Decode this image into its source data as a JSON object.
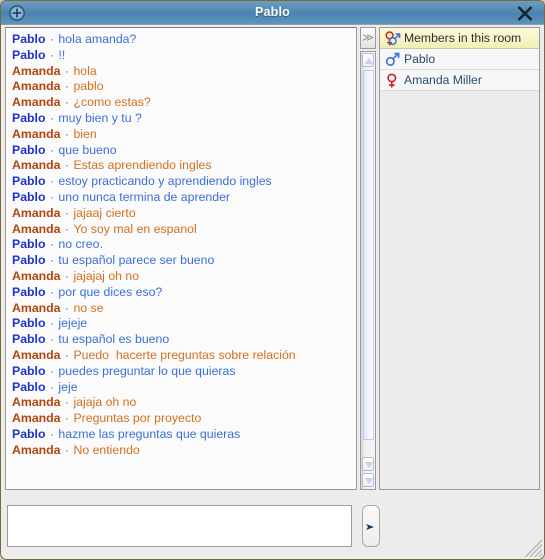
{
  "window": {
    "title": "Pablo",
    "add_icon": "circle-plus-icon",
    "close_icon": "close-icon",
    "close_label": "✕"
  },
  "colors": {
    "titlebar_blue": "#5089b4",
    "pablo_name": "#1b35cc",
    "pablo_text": "#3a6fd8",
    "amanda_name": "#b04510",
    "amanda_text": "#d4701e",
    "members_header_bg": "#f0eeb4",
    "member_text": "#2b4a6f",
    "mars_blue": "#3a6fd8",
    "venus_red": "#d01f1f"
  },
  "chat": {
    "separator": "·",
    "messages": [
      {
        "sender": "Pablo",
        "side": "pablo",
        "text": "hola amanda?"
      },
      {
        "sender": "Pablo",
        "side": "pablo",
        "text": "!!"
      },
      {
        "sender": "Amanda",
        "side": "amanda",
        "text": "hola"
      },
      {
        "sender": "Amanda",
        "side": "amanda",
        "text": "pablo"
      },
      {
        "sender": "Amanda",
        "side": "amanda",
        "text": "¿como estas?"
      },
      {
        "sender": "Pablo",
        "side": "pablo",
        "text": "muy bien y tu ?"
      },
      {
        "sender": "Amanda",
        "side": "amanda",
        "text": "bien"
      },
      {
        "sender": "Pablo",
        "side": "pablo",
        "text": "que bueno"
      },
      {
        "sender": "Amanda",
        "side": "amanda",
        "text": "Estas aprendiendo ingles"
      },
      {
        "sender": "Pablo",
        "side": "pablo",
        "text": "estoy practicando y aprendiendo ingles"
      },
      {
        "sender": "Pablo",
        "side": "pablo",
        "text": "uno nunca termina de aprender"
      },
      {
        "sender": "Amanda",
        "side": "amanda",
        "text": "jajaaj cierto"
      },
      {
        "sender": "Amanda",
        "side": "amanda",
        "text": "Yo soy mal en espanol"
      },
      {
        "sender": "Pablo",
        "side": "pablo",
        "text": "no creo."
      },
      {
        "sender": "Pablo",
        "side": "pablo",
        "text": "tu español parece ser bueno"
      },
      {
        "sender": "Amanda",
        "side": "amanda",
        "text": "jajajaj oh no"
      },
      {
        "sender": "Pablo",
        "side": "pablo",
        "text": "por que dices eso?"
      },
      {
        "sender": "Amanda",
        "side": "amanda",
        "text": "no se"
      },
      {
        "sender": "Pablo",
        "side": "pablo",
        "text": "jejeje"
      },
      {
        "sender": "Pablo",
        "side": "pablo",
        "text": "tu español es bueno"
      },
      {
        "sender": "Amanda",
        "side": "amanda",
        "text": "Puedo  hacerte preguntas sobre relación"
      },
      {
        "sender": "Pablo",
        "side": "pablo",
        "text": "puedes preguntar lo que quieras"
      },
      {
        "sender": "Pablo",
        "side": "pablo",
        "text": "jeje"
      },
      {
        "sender": "Amanda",
        "side": "amanda",
        "text": "jajaja oh no"
      },
      {
        "sender": "Amanda",
        "side": "amanda",
        "text": "Preguntas por proyecto"
      },
      {
        "sender": "Pablo",
        "side": "pablo",
        "text": "hazme las preguntas que quieras"
      },
      {
        "sender": "Amanda",
        "side": "amanda",
        "text": "No entiendo"
      }
    ]
  },
  "chat_scrollbar": {
    "collapse_label": "≫",
    "collapse_icon": "chevron-double-right-icon",
    "up_icon": "triangle-up-icon",
    "down_icon": "triangle-down-icon",
    "bottom_icon": "triangle-down-bar-icon"
  },
  "members": {
    "header_label": "Members in this room",
    "header_icon": "venus-mars-icon",
    "items": [
      {
        "name": "Pablo",
        "gender": "male",
        "icon": "mars-icon"
      },
      {
        "name": "Amanda Miller",
        "gender": "female",
        "icon": "venus-icon"
      }
    ]
  },
  "composer": {
    "value": "",
    "placeholder": "",
    "send_label": "➤",
    "send_icon": "send-arrow-icon",
    "resize_icon": "resize-grip-icon"
  }
}
